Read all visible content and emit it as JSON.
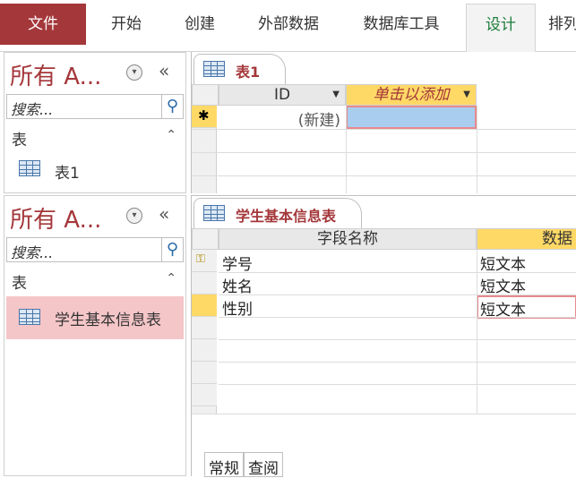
{
  "ribbon": {
    "tabs": [
      {
        "label": "文件"
      },
      {
        "label": "开始"
      },
      {
        "label": "创建"
      },
      {
        "label": "外部数据"
      },
      {
        "label": "数据库工具"
      },
      {
        "label": "设计"
      },
      {
        "label": "排列"
      }
    ]
  },
  "nav_panes": [
    {
      "title": "所有 A...",
      "search_placeholder": "搜索...",
      "group_label": "表",
      "item_label": "表1"
    },
    {
      "title": "所有 A...",
      "search_placeholder": "搜索...",
      "group_label": "表",
      "item_label": "学生基本信息表"
    }
  ],
  "datasheet": {
    "tab_title": "表1",
    "columns": [
      "ID",
      "单击以添加"
    ],
    "new_row_marker": "✱",
    "new_row_value": "(新建)"
  },
  "design_view": {
    "tab_title": "学生基本信息表",
    "columns": [
      "字段名称",
      "数据"
    ],
    "rows": [
      {
        "field": "学号",
        "type": "短文本"
      },
      {
        "field": "姓名",
        "type": "短文本"
      },
      {
        "field": "性别",
        "type": "短文本"
      }
    ],
    "bottom_tabs": [
      "常规",
      "查阅"
    ]
  },
  "colors": {
    "accent": "#a4373a",
    "active_tab_text": "#1a7d3a",
    "header_yellow": "#ffd966",
    "selected_cell": "#a9cdef",
    "selected_nav": "#f5c6c8"
  }
}
